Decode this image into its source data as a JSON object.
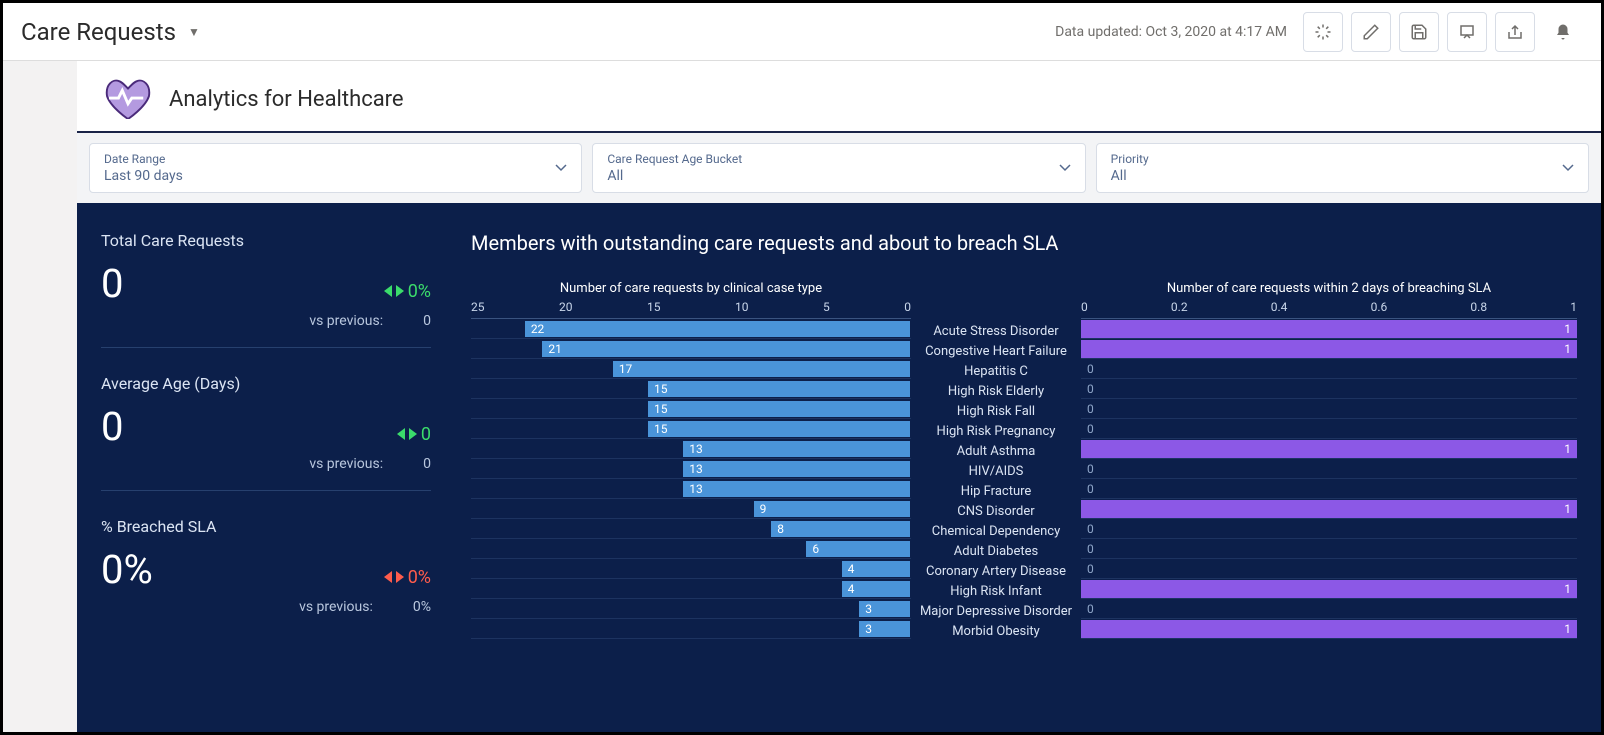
{
  "header": {
    "page_title": "Care Requests",
    "updated_text": "Data updated: Oct 3, 2020 at 4:17 AM"
  },
  "app": {
    "title": "Analytics for Healthcare"
  },
  "filters": {
    "date_range": {
      "label": "Date Range",
      "value": "Last 90 days"
    },
    "age_bucket": {
      "label": "Care Request Age Bucket",
      "value": "All"
    },
    "priority": {
      "label": "Priority",
      "value": "All"
    }
  },
  "kpis": {
    "total": {
      "label": "Total Care Requests",
      "value": "0",
      "delta": "0%",
      "vs_label": "vs previous:",
      "vs_value": "0"
    },
    "avg_age": {
      "label": "Average Age (Days)",
      "value": "0",
      "delta": "0",
      "vs_label": "vs previous:",
      "vs_value": "0"
    },
    "breached": {
      "label": "% Breached SLA",
      "value": "0%",
      "delta": "0%",
      "vs_label": "vs previous:",
      "vs_value": "0%"
    }
  },
  "chart_title": "Members with outstanding care requests and about to breach SLA",
  "chart_data": {
    "type": "bar",
    "title": "Members with outstanding care requests and about to breach SLA",
    "categories": [
      "Acute Stress Disorder",
      "Congestive Heart Failure",
      "Hepatitis C",
      "High Risk Elderly",
      "High Risk Fall",
      "High Risk Pregnancy",
      "Adult Asthma",
      "HIV/AIDS",
      "Hip Fracture",
      "CNS Disorder",
      "Chemical Dependency",
      "Adult Diabetes",
      "Coronary Artery Disease",
      "High Risk Infant",
      "Major Depressive Disorder",
      "Morbid Obesity"
    ],
    "series": [
      {
        "name": "Number of care requests by clinical case type",
        "values": [
          22,
          21,
          17,
          15,
          15,
          15,
          13,
          13,
          13,
          9,
          8,
          6,
          4,
          4,
          3,
          3
        ],
        "xlim": [
          25,
          0
        ],
        "ticks": [
          25,
          20,
          15,
          10,
          5,
          0
        ]
      },
      {
        "name": "Number of care requests within 2 days of breaching SLA",
        "values": [
          1,
          1,
          0,
          0,
          0,
          0,
          1,
          0,
          0,
          1,
          0,
          0,
          0,
          1,
          0,
          1
        ],
        "xlim": [
          0,
          1
        ],
        "ticks": [
          0,
          0.2,
          0.4,
          0.6,
          0.8,
          1
        ]
      }
    ]
  }
}
